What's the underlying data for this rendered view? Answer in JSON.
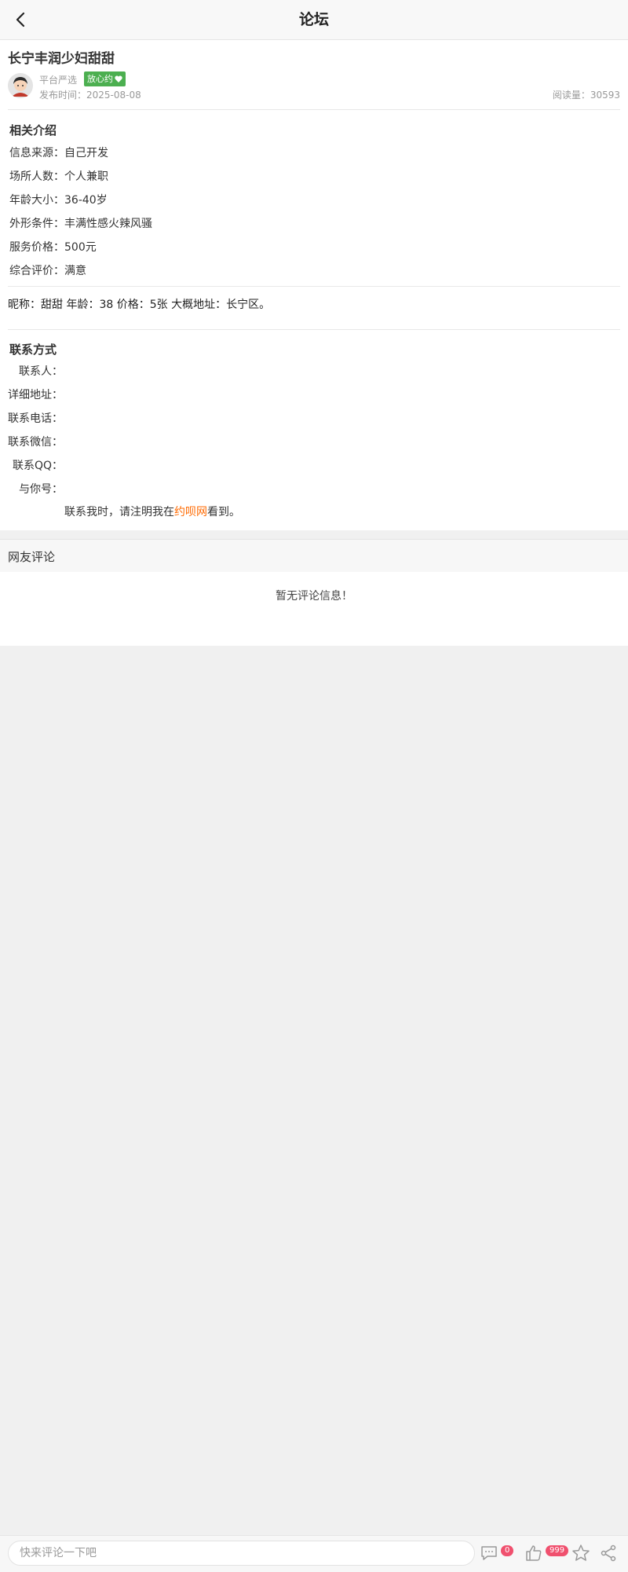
{
  "header": {
    "title": "论坛"
  },
  "post": {
    "title": "长宁丰润少妇甜甜",
    "author": "平台严选",
    "badge": "放心约",
    "publish_time": "发布时间：2025-08-08",
    "reads": "阅读量：30593"
  },
  "intro": {
    "title": "相关介绍",
    "rows": [
      "信息来源：自己开发",
      "场所人数：个人兼职",
      "年龄大小：36-40岁",
      "外形条件：丰满性感火辣风骚",
      "服务价格：500元",
      "综合评价：满意"
    ]
  },
  "summary": "昵称：甜甜 年龄：38 价格：5张 大概地址：长宁区。",
  "contact": {
    "title": "联系方式",
    "labels": [
      "联系人：",
      "详细地址：",
      "联系电话：",
      "联系微信：",
      "联系QQ：",
      "与你号："
    ],
    "note_prefix": "联系我时，请注明我在",
    "note_brand": "约呗网",
    "note_suffix": "看到。"
  },
  "comments": {
    "title": "网友评论",
    "empty": "暂无评论信息！"
  },
  "bottom_bar": {
    "input_placeholder": "快来评论一下吧",
    "comment_count": "0",
    "like_count": "999",
    "icons": [
      "comment-icon",
      "like-icon",
      "star-icon",
      "share-icon"
    ]
  },
  "colors": {
    "badge_green": "#4caf50",
    "brand_orange": "#ff6a00",
    "count_red": "#f0506e"
  }
}
